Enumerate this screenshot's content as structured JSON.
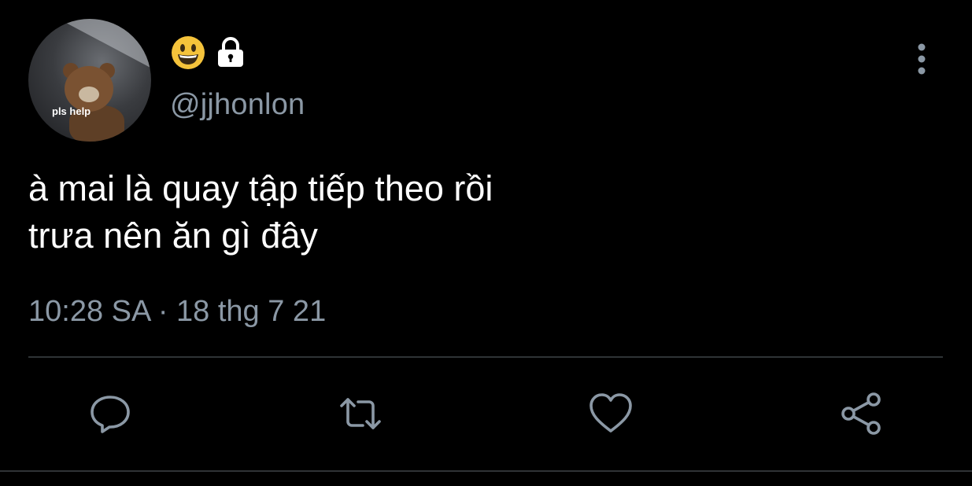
{
  "user": {
    "avatar_caption": "pls help",
    "display_name_icons": [
      "grinning-face-emoji-icon",
      "lock-icon"
    ],
    "handle": "@jjhonlon"
  },
  "tweet": {
    "lines": [
      "à mai là quay tập tiếp theo rồi",
      "trưa nên ăn gì đây"
    ],
    "time": "10:28 SA",
    "separator": "·",
    "date": "18 thg 7 21"
  },
  "actions": [
    {
      "name": "reply",
      "icon": "comment-icon"
    },
    {
      "name": "retweet",
      "icon": "retweet-icon"
    },
    {
      "name": "like",
      "icon": "heart-icon"
    },
    {
      "name": "share",
      "icon": "share-icon"
    }
  ],
  "colors": {
    "background": "#000000",
    "text_primary": "#ffffff",
    "text_secondary": "#8b98a5",
    "divider": "#2f3336"
  }
}
